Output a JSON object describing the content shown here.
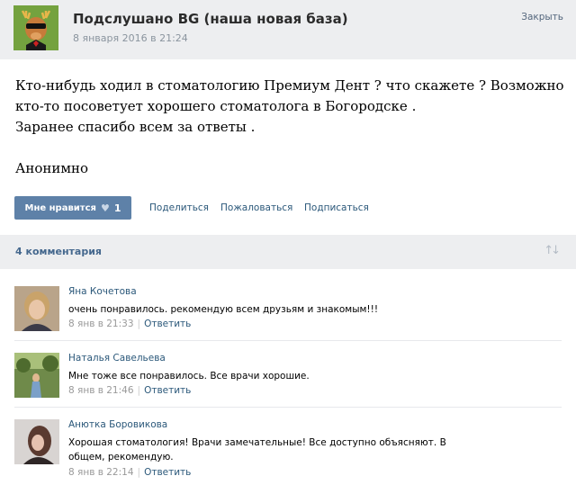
{
  "post": {
    "group_name": "Подслушано BG (наша новая база)",
    "date": "8 января 2016 в 21:24",
    "close_label": "Закрыть",
    "text_lines": [
      "Кто-нибудь ходил в стоматологию Премиум Дент ? что скажете ? Возможно",
      "кто-то посоветует хорошего стоматолога в Богородске .",
      "Заранее спасибо всем за ответы .",
      "",
      "Анонимно"
    ],
    "actions": {
      "like_label": "Мне нравится",
      "like_count": "1",
      "share_label": "Поделиться",
      "report_label": "Пожаловаться",
      "subscribe_label": "Подписаться"
    },
    "icons": {
      "avatar": "deer-mascot-avatar",
      "like": "heart-icon"
    }
  },
  "comments_header": {
    "count_label": "4 комментария",
    "sort_icon": "sort-arrows-icon"
  },
  "comments": [
    {
      "author": "Яна Кочетова",
      "text": "очень понравилось. рекомендую всем друзьям и знакомым!!!",
      "time": "8 янв в 21:33",
      "reply_label": "Ответить"
    },
    {
      "author": "Наталья Савельева",
      "text": "Мне тоже все понравилось. Все врачи хорошие.",
      "time": "8 янв в 21:46",
      "reply_label": "Ответить"
    },
    {
      "author": "Анютка Боровикова",
      "text": "Хорошая стоматология! Врачи замечательные! Все доступно объясняют. В общем, рекомендую.",
      "time": "8 янв в 22:14",
      "reply_label": "Ответить"
    }
  ],
  "colors": {
    "header_bg": "#edeef0",
    "link": "#2b587a",
    "like_button": "#5e81a8",
    "muted": "#8a949e"
  }
}
